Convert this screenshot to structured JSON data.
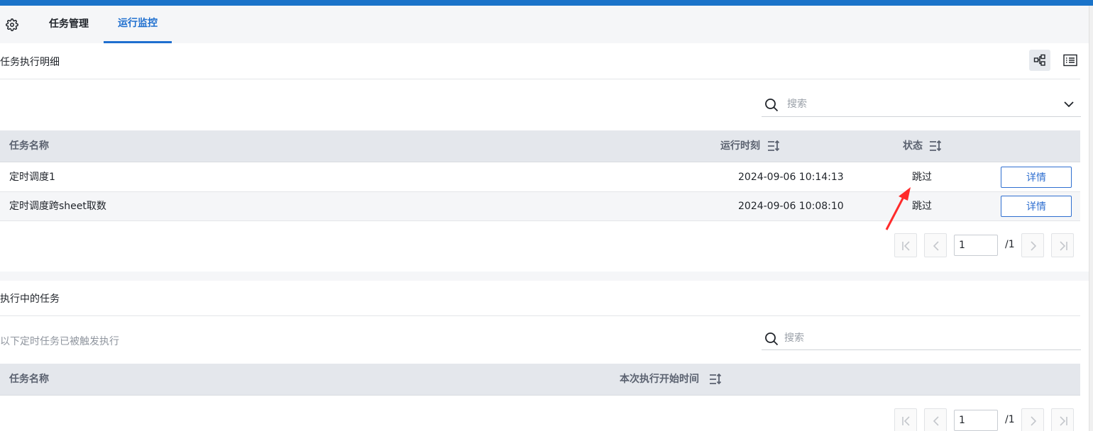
{
  "tabs": {
    "task_management": "任务管理",
    "run_monitor": "运行监控"
  },
  "detail_section": {
    "title": "任务执行明细",
    "search_placeholder": "搜索",
    "columns": {
      "name": "任务名称",
      "run_time": "运行时刻",
      "status": "状态"
    },
    "rows": [
      {
        "name": "定时调度1",
        "run_time": "2024-09-06 10:14:13",
        "status": "跳过",
        "action": "详情"
      },
      {
        "name": "定时调度跨sheet取数",
        "run_time": "2024-09-06 10:08:10",
        "status": "跳过",
        "action": "详情"
      }
    ],
    "pager": {
      "page": "1",
      "total": "/1"
    }
  },
  "running_section": {
    "title": "执行中的任务",
    "hint": "以下定时任务已被触发执行",
    "search_placeholder": "搜索",
    "columns": {
      "name": "任务名称",
      "start_time": "本次执行开始时间"
    },
    "pager": {
      "page": "1",
      "total": "/1"
    }
  },
  "colors": {
    "accent": "#1f6fcf",
    "annotation_arrow": "#ff2b2b"
  }
}
